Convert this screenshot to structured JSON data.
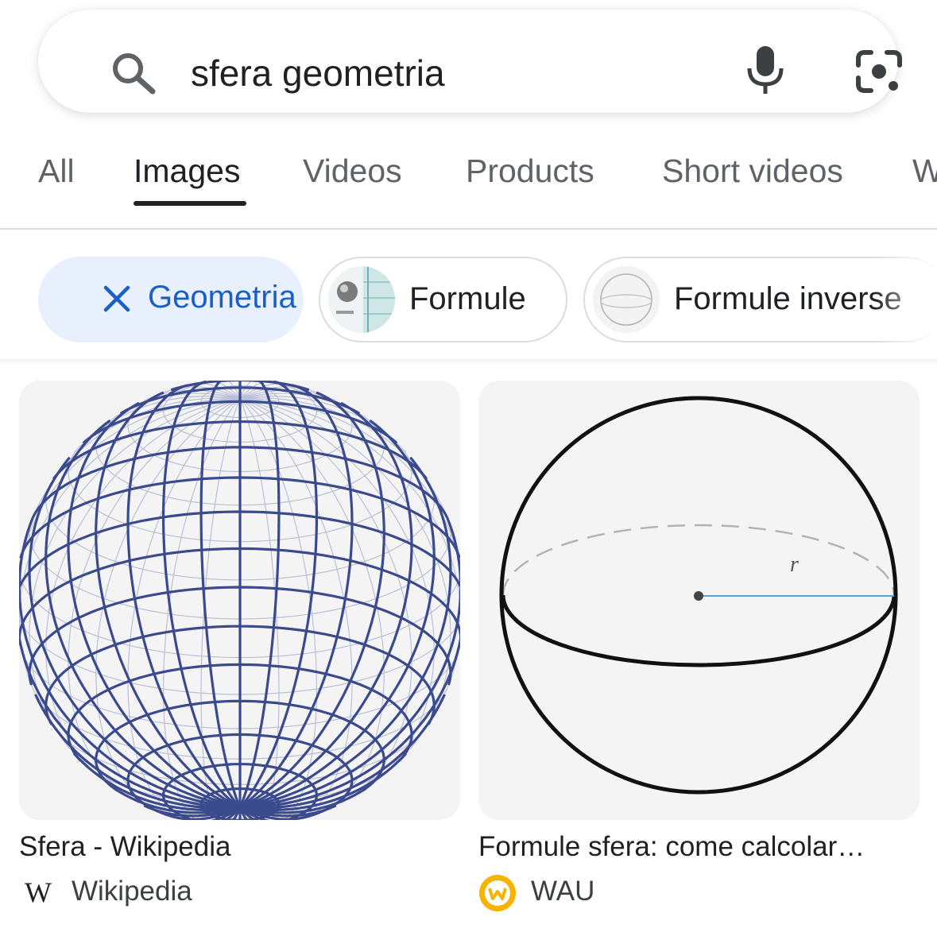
{
  "search": {
    "query": "sfera geometria"
  },
  "tabs": [
    {
      "label": "All"
    },
    {
      "label": "Images"
    },
    {
      "label": "Videos"
    },
    {
      "label": "Products"
    },
    {
      "label": "Short videos"
    },
    {
      "label": "W"
    }
  ],
  "active_tab": "Images",
  "chips": [
    {
      "label": "Geometria",
      "selected": true
    },
    {
      "label": "Formule"
    },
    {
      "label": "Formule inverse"
    }
  ],
  "results": [
    {
      "title": "Sfera - Wikipedia",
      "source": "Wikipedia"
    },
    {
      "title": "Formule sfera: come calcolar…",
      "source": "WAU",
      "diagram_label": "r"
    }
  ],
  "colors": {
    "accent_blue": "#1a5fc6",
    "chip_selected_bg": "#e8f0fe",
    "sphere_line": "#3a4a8c",
    "wau_logo": "#f4b400"
  }
}
